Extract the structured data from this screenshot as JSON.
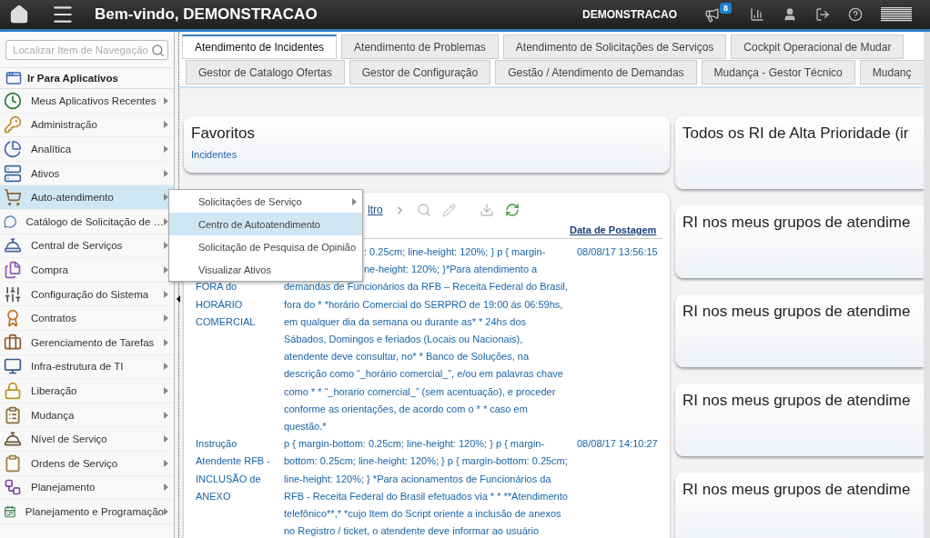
{
  "header": {
    "title": "Bem-vindo, DEMONSTRACAO",
    "user": "DEMONSTRACAO",
    "notification_count": "8"
  },
  "sidebar": {
    "search": {
      "placeholder": "Localizar Item de Navegação"
    },
    "goto_apps": "Ir Para Aplicativos",
    "items": [
      {
        "label": "Meus Aplicativos Recentes",
        "selected": false,
        "has_submenu": true
      },
      {
        "label": "Administração",
        "selected": false,
        "has_submenu": true
      },
      {
        "label": "Analítica",
        "selected": false,
        "has_submenu": true
      },
      {
        "label": "Ativos",
        "selected": false,
        "has_submenu": true
      },
      {
        "label": "Auto-atendimento",
        "selected": true,
        "has_submenu": true
      },
      {
        "label": "Catálogo de Solicitação de …",
        "selected": false,
        "has_submenu": true
      },
      {
        "label": "Central de Serviços",
        "selected": false,
        "has_submenu": true
      },
      {
        "label": "Compra",
        "selected": false,
        "has_submenu": true
      },
      {
        "label": "Configuração do Sistema",
        "selected": false,
        "has_submenu": true
      },
      {
        "label": "Contratos",
        "selected": false,
        "has_submenu": true
      },
      {
        "label": "Gerenciamento de Tarefas",
        "selected": false,
        "has_submenu": true
      },
      {
        "label": "Infra-estrutura de TI",
        "selected": false,
        "has_submenu": true
      },
      {
        "label": "Liberação",
        "selected": false,
        "has_submenu": true
      },
      {
        "label": "Mudança",
        "selected": false,
        "has_submenu": true
      },
      {
        "label": "Nível de Serviço",
        "selected": false,
        "has_submenu": true
      },
      {
        "label": "Ordens de Serviço",
        "selected": false,
        "has_submenu": true
      },
      {
        "label": "Planejamento",
        "selected": false,
        "has_submenu": true
      },
      {
        "label": "Planejamento e Programação",
        "selected": false,
        "has_submenu": true
      }
    ]
  },
  "submenu": {
    "items": [
      {
        "label": "Solicitações de Serviço",
        "selected": false,
        "has_submenu": true
      },
      {
        "label": "Centro de Autoatendimento",
        "selected": true,
        "has_submenu": false
      },
      {
        "label": "Solicitação de Pesquisa de Opinião",
        "selected": false,
        "has_submenu": false
      },
      {
        "label": "Visualizar Ativos",
        "selected": false,
        "has_submenu": false
      }
    ]
  },
  "tabs": {
    "rows": [
      [
        {
          "label": "Atendimento de Incidentes",
          "selected": true
        },
        {
          "label": "Atendimento de Problemas",
          "selected": false
        },
        {
          "label": "Atendimento de Solicitações de Serviços",
          "selected": false
        },
        {
          "label": "Cockpit Operacional de Mudar",
          "selected": false
        }
      ],
      [
        {
          "label": "Gestor de Catalogo Ofertas",
          "selected": false
        },
        {
          "label": "Gestor de Configuração",
          "selected": false
        },
        {
          "label": "Gestão / Atendimento de Demandas",
          "selected": false
        },
        {
          "label": "Mudança - Gestor Técnico",
          "selected": false
        },
        {
          "label": "Mudanç",
          "selected": false
        }
      ]
    ]
  },
  "favorites": {
    "title": "Favoritos",
    "links": [
      "Incidentes"
    ]
  },
  "table": {
    "toolbar_link": "ltro",
    "columns": [
      "Data de Postagem"
    ],
    "rows": [
      {
        "title": "FORA do HORÁRIO COMERCIAL",
        "description_head": [
          ": 0.25cm; line-height: 120%; } p { margin-",
          "ne-height: 120%; }*Para atendimento a"
        ],
        "description": "demandas de Funcionários da RFB – Receita Federal do Brasil, fora do * *horário Comercial do SERPRO de 19:00 ás 06:59hs, em qualquer dia da semana ou durante as* * 24hs dos Sábados, Domingos e feriados (Locais ou Nacionais), atendente deve consultar, no* * Banco de Soluções, na descrição como “_horário comercial_”, e/ou em palavras chave como * * “_horario comercial_” (sem acentuação), e proceder conforme as orientações, de acordo com o * * caso em questão.*",
        "date": "08/08/17 13:56:15"
      },
      {
        "title": "Instrução Atendente RFB - INCLUSÃO de ANEXO",
        "description_head": [],
        "description": "p { margin-bottom: 0.25cm; line-height: 120%; } p { margin-bottom: 0.25cm; line-height: 120%; } p { margin-bottom: 0.25cm; line-height: 120%; } *Para acionamentos de Funcionários da RFB - Receita Federal do Brasil efetuados via * * **Atendimento telefônico**,* *cujo Item do Script oriente a inclusão de anexos no Registro / ticket, o atendente deve informar ao usuário",
        "date": "08/08/17 14:10:27"
      }
    ]
  },
  "side_cards": [
    {
      "title": "Todos os RI de Alta Prioridade (ir"
    },
    {
      "title": "RI nos meus grupos de atendime"
    },
    {
      "title": "RI nos meus grupos de atendime"
    },
    {
      "title": "RI nos meus grupos de atendime"
    },
    {
      "title": "RI nos meus grupos de atendime"
    }
  ]
}
